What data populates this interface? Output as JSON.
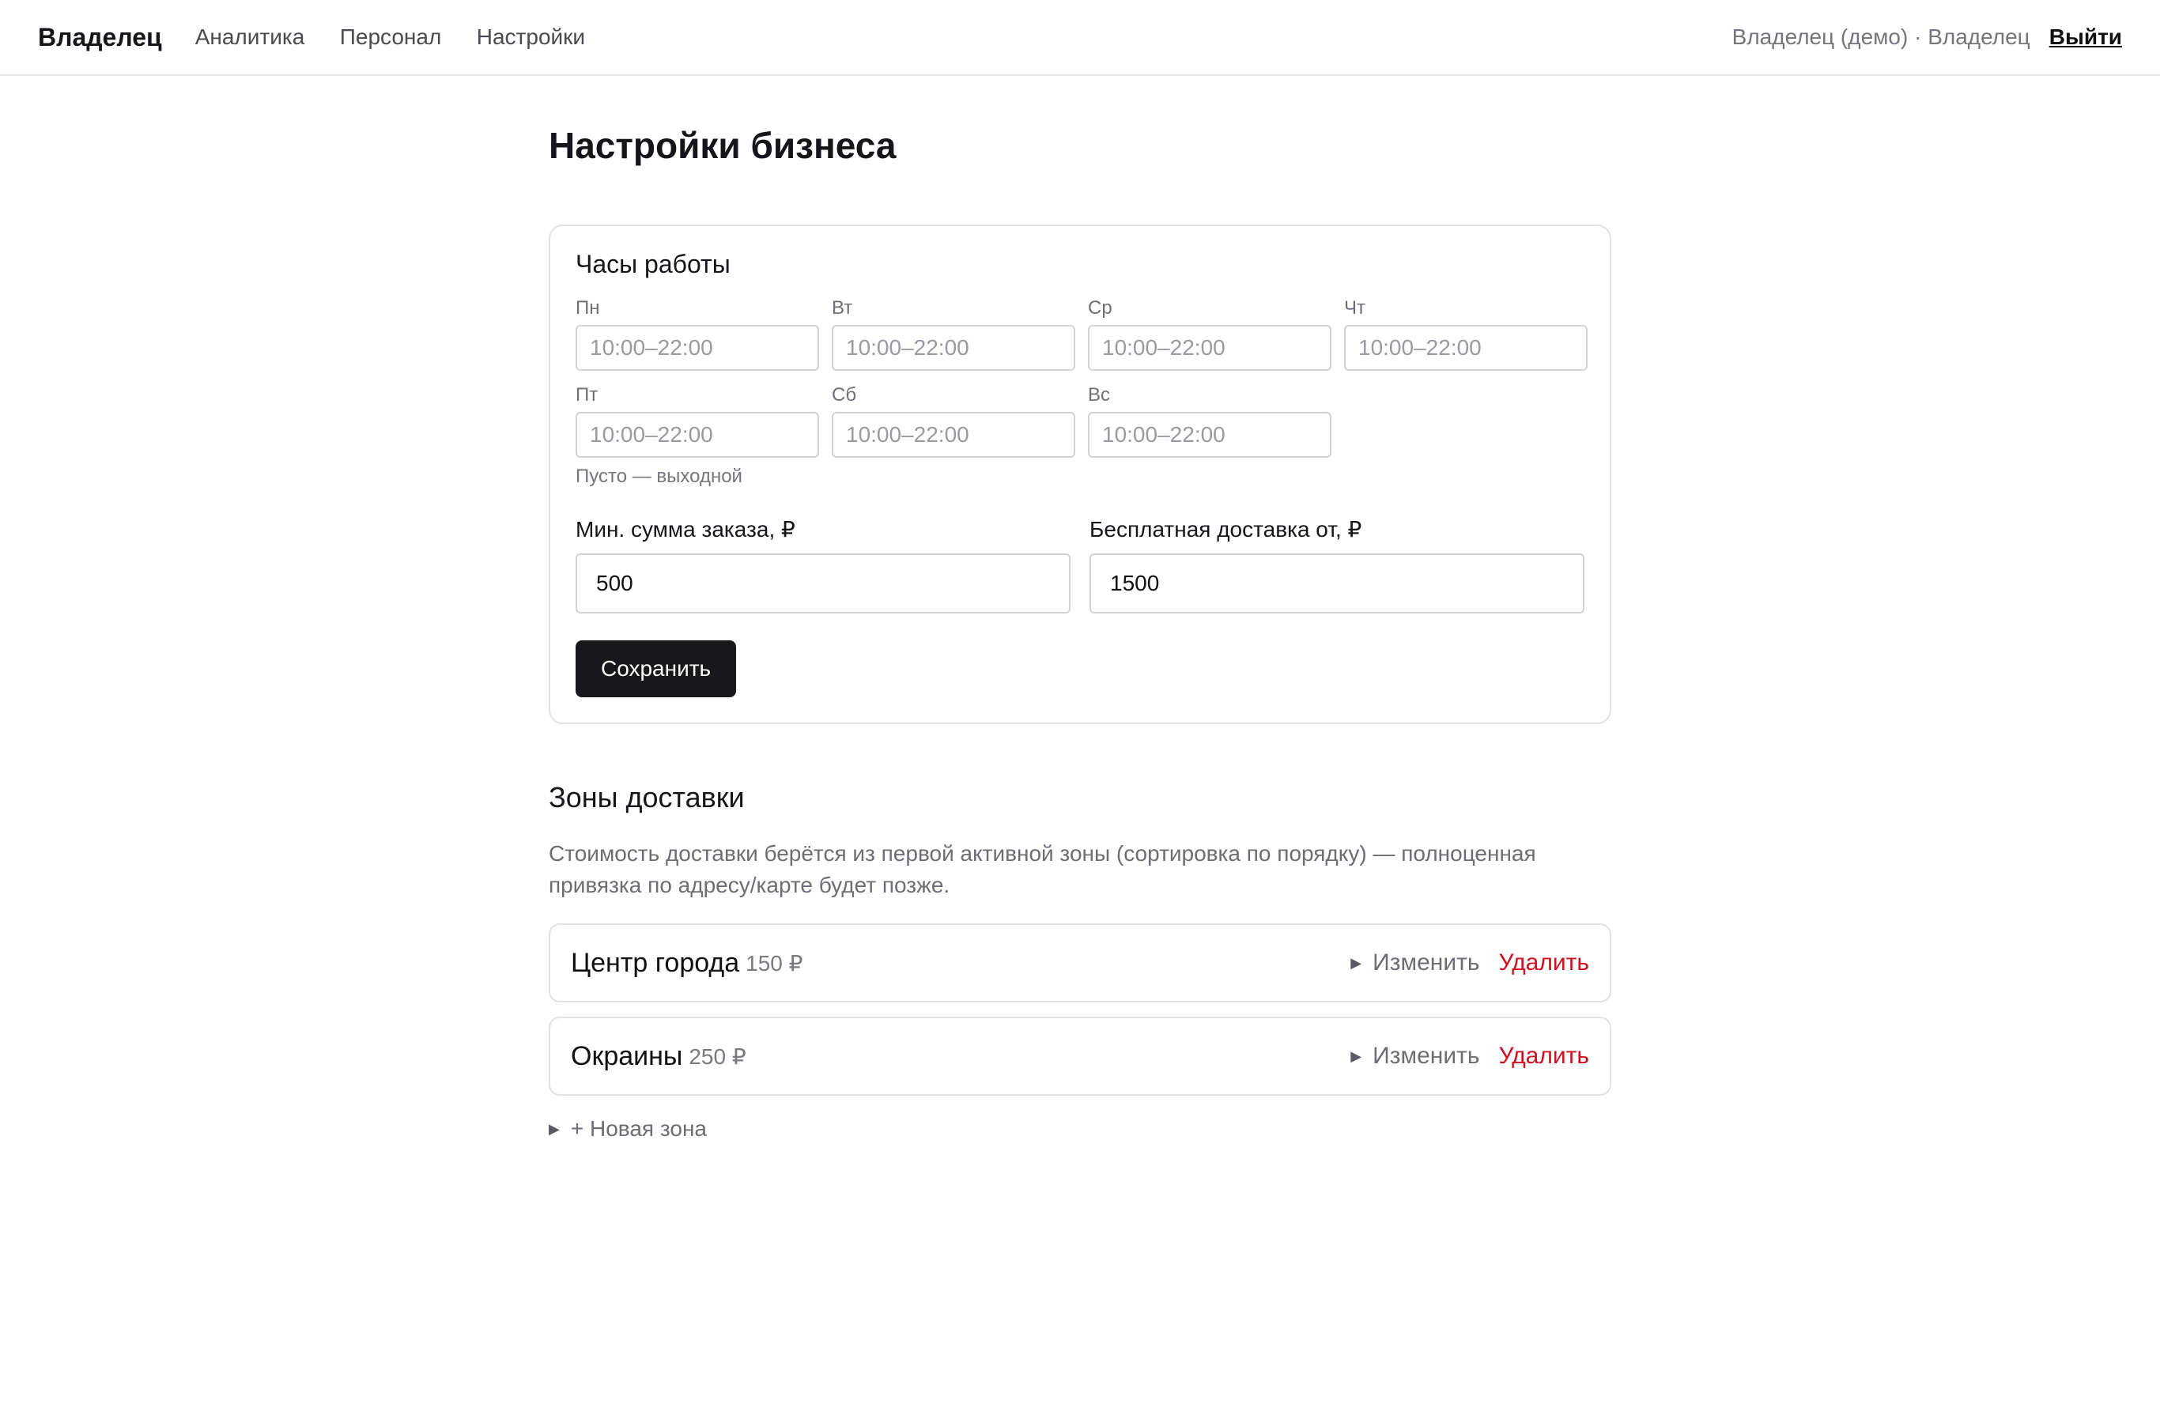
{
  "header": {
    "brand": "Владелец",
    "nav": [
      "Аналитика",
      "Персонал",
      "Настройки"
    ],
    "user": "Владелец (демо) · Владелец",
    "logout": "Выйти"
  },
  "page": {
    "title": "Настройки бизнеса"
  },
  "hours": {
    "title": "Часы работы",
    "days": [
      {
        "label": "Пн",
        "placeholder": "10:00–22:00"
      },
      {
        "label": "Вт",
        "placeholder": "10:00–22:00"
      },
      {
        "label": "Ср",
        "placeholder": "10:00–22:00"
      },
      {
        "label": "Чт",
        "placeholder": "10:00–22:00"
      },
      {
        "label": "Пт",
        "placeholder": "10:00–22:00"
      },
      {
        "label": "Сб",
        "placeholder": "10:00–22:00"
      },
      {
        "label": "Вс",
        "placeholder": "10:00–22:00"
      }
    ],
    "hint": "Пусто — выходной"
  },
  "money": {
    "min_order_label": "Мин. сумма заказа, ₽",
    "min_order_value": "500",
    "free_delivery_label": "Бесплатная доставка от, ₽",
    "free_delivery_value": "1500"
  },
  "save_label": "Сохранить",
  "zones": {
    "title": "Зоны доставки",
    "description": "Стоимость доставки берётся из первой активной зоны (сортировка по порядку) — полноценная привязка по адресу/карте будет позже.",
    "items": [
      {
        "name": "Центр города",
        "price": "150 ₽",
        "edit": "Изменить",
        "delete": "Удалить"
      },
      {
        "name": "Окраины",
        "price": "250 ₽",
        "edit": "Изменить",
        "delete": "Удалить"
      }
    ],
    "new_zone": "+ Новая зона"
  },
  "colors": {
    "danger": "#d0101f",
    "button": "#18181b",
    "muted": "#6d6d75"
  },
  "icons": {
    "disclosure": "triangle-right-icon"
  }
}
